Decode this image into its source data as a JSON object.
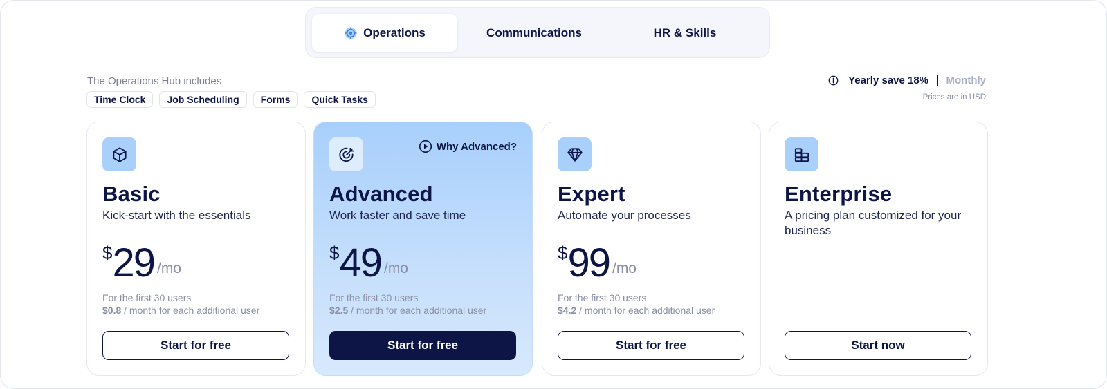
{
  "tabs": [
    {
      "label": "Operations",
      "active": true,
      "icon": "gear-badge-icon"
    },
    {
      "label": "Communications",
      "active": false
    },
    {
      "label": "HR & Skills",
      "active": false
    }
  ],
  "includes": {
    "label": "The Operations Hub includes",
    "chips": [
      "Time Clock",
      "Job Scheduling",
      "Forms",
      "Quick Tasks"
    ]
  },
  "billing": {
    "yearly_label": "Yearly save 18%",
    "monthly_label": "Monthly",
    "currency_note": "Prices are in USD",
    "selected": "yearly"
  },
  "plans": [
    {
      "name": "Basic",
      "subtitle": "Kick-start with the essentials",
      "icon": "cube-icon",
      "currency": "$",
      "price": "29",
      "period": "/mo",
      "note": "For the first 30 users",
      "extra_price": "$0.8",
      "extra_text": " / month for each additional user",
      "cta": "Start for free"
    },
    {
      "name": "Advanced",
      "subtitle": "Work faster and save time",
      "icon": "target-icon",
      "currency": "$",
      "price": "49",
      "period": "/mo",
      "note": "For the first 30 users",
      "extra_price": "$2.5",
      "extra_text": " / month for each additional user",
      "cta": "Start for free",
      "why_label": "Why Advanced?",
      "featured": true
    },
    {
      "name": "Expert",
      "subtitle": "Automate your processes",
      "icon": "diamond-icon",
      "currency": "$",
      "price": "99",
      "period": "/mo",
      "note": "For the first 30 users",
      "extra_price": "$4.2",
      "extra_text": " / month for each additional user",
      "cta": "Start for free"
    },
    {
      "name": "Enterprise",
      "subtitle": "A pricing plan customized for your business",
      "icon": "building-blocks-icon",
      "cta": "Start now"
    }
  ],
  "colors": {
    "navy": "#0d1547",
    "accent_blue": "#a9d0fb",
    "muted": "#8a8fa4"
  }
}
